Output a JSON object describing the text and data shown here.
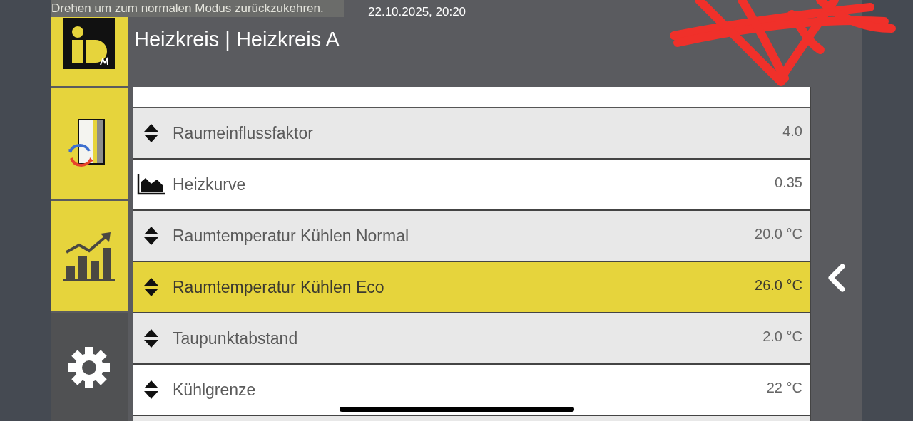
{
  "notice": "Drehen um zum normalen Modus zurückzukehren.",
  "datetime": "22.10.2025, 20:20",
  "title": "Heizkreis | Heizkreis A",
  "sidebar": [
    {
      "kind": "system"
    },
    {
      "kind": "statistics"
    },
    {
      "kind": "settings"
    }
  ],
  "rows": [
    {
      "kind": "updown",
      "label": "Raumeinflussfaktor",
      "value": "4.0",
      "selected": false
    },
    {
      "kind": "curve",
      "label": "Heizkurve",
      "value": "0.35",
      "selected": false
    },
    {
      "kind": "updown",
      "label": "Raumtemperatur Kühlen Normal",
      "value": "20.0 °C",
      "selected": false
    },
    {
      "kind": "updown",
      "label": "Raumtemperatur Kühlen Eco",
      "value": "26.0 °C",
      "selected": true
    },
    {
      "kind": "updown",
      "label": "Taupunktabstand",
      "value": "2.0 °C",
      "selected": false
    },
    {
      "kind": "updown",
      "label": "Kühlgrenze",
      "value": "22 °C",
      "selected": false
    }
  ]
}
